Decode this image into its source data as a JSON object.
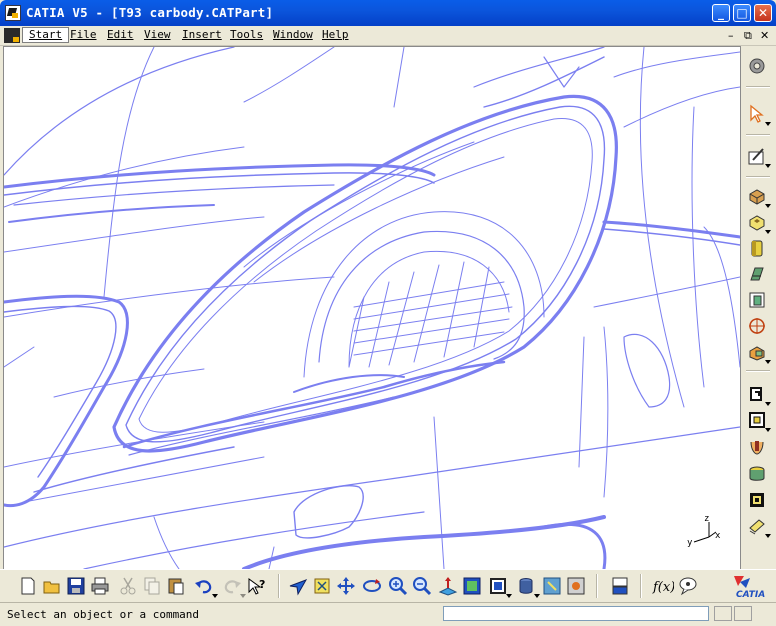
{
  "window": {
    "title": "CATIA V5 - [T93 carbody.CATPart]",
    "minimize": "_",
    "maximize": "□",
    "close": "✕"
  },
  "menu": {
    "items": [
      "Start",
      "File",
      "Edit",
      "View",
      "Insert",
      "Tools",
      "Window",
      "Help"
    ],
    "mdi_controls": [
      "–",
      "⧉",
      "✕"
    ]
  },
  "viewport": {
    "axis_labels": {
      "x": "x",
      "y": "y",
      "z": "z"
    },
    "wire_color": "#7b7ff0"
  },
  "right_toolbar": {
    "icons": [
      "gear-icon",
      "select-arrow-icon",
      "sketch-icon",
      "pad-icon",
      "pocket-icon",
      "shaft-icon",
      "groove-icon",
      "hole-icon",
      "rib-icon",
      "slot-icon",
      "stiffener-icon",
      "loft-icon",
      "remove-loft-icon",
      "fillet-icon",
      "shell-icon",
      "thickness-icon",
      "hide-show-icon"
    ]
  },
  "bottom_toolbar": {
    "icons": [
      "new-icon",
      "open-icon",
      "save-icon",
      "print-icon",
      "cut-icon",
      "copy-icon",
      "paste-icon",
      "undo-icon",
      "redo-icon",
      "whats-this-icon",
      "fly-icon",
      "fit-all-icon",
      "pan-icon",
      "rotate-icon",
      "zoom-in-icon",
      "zoom-out-icon",
      "normal-view-icon",
      "iso-view-icon",
      "render-style-icon",
      "hide-icon",
      "swap-space-icon",
      "material-icon",
      "catalog-icon",
      "formula-icon",
      "knowledge-icon",
      "catia-logo"
    ],
    "logo_text": "CATIA"
  },
  "status": {
    "message": "Select an object or a command",
    "command_input": ""
  }
}
